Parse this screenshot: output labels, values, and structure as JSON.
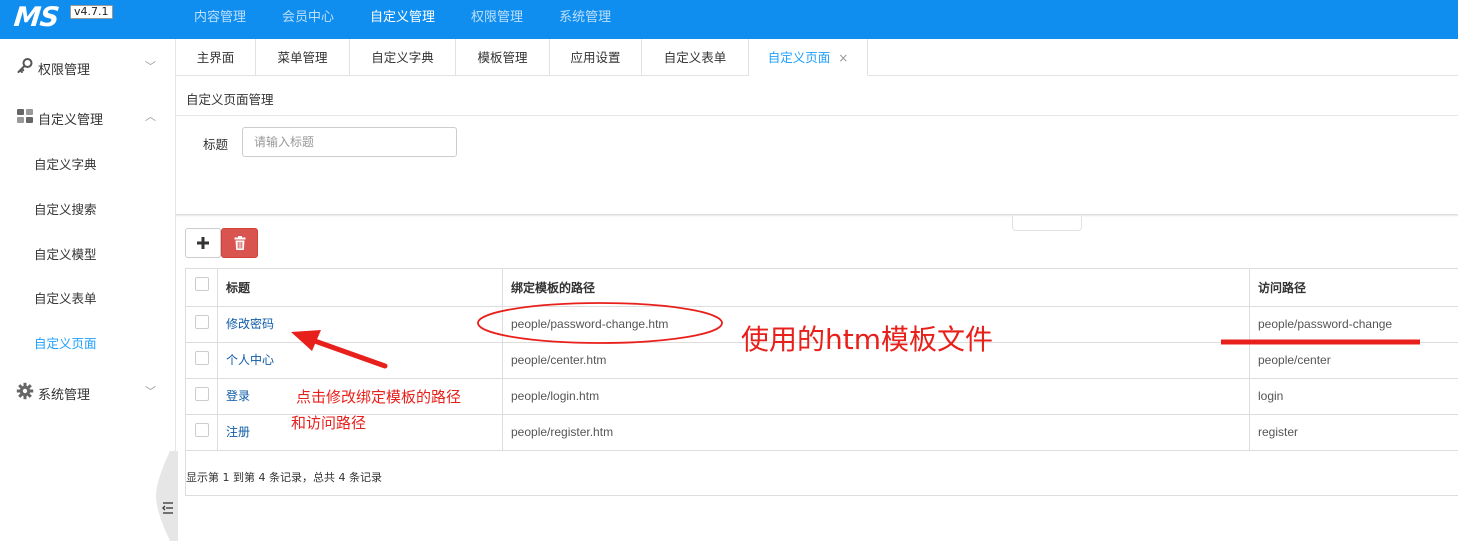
{
  "app": {
    "logo": "MS",
    "version": "v4.7.1"
  },
  "topnav": [
    "内容管理",
    "会员中心",
    "自定义管理",
    "权限管理",
    "系统管理"
  ],
  "sidebar": {
    "groups": [
      {
        "label": "权限管理",
        "icon": "key-icon"
      },
      {
        "label": "自定义管理",
        "icon": "grid-icon"
      },
      {
        "label": "系统管理",
        "icon": "gear-icon"
      }
    ],
    "items": [
      "自定义字典",
      "自定义搜索",
      "自定义模型",
      "自定义表单",
      "自定义页面"
    ]
  },
  "tabs": [
    "主界面",
    "菜单管理",
    "自定义字典",
    "模板管理",
    "应用设置",
    "自定义表单",
    "自定义页面"
  ],
  "tab_close": "×",
  "main": {
    "heading": "自定义页面管理",
    "search": {
      "label": "标题",
      "placeholder": "请输入标题",
      "value": ""
    }
  },
  "buttons": {
    "add": "+",
    "delete": "delete"
  },
  "table": {
    "headers": [
      "标题",
      "绑定模板的路径",
      "访问路径"
    ],
    "rows": [
      {
        "title": "修改密码",
        "template": "people/password-change.htm",
        "url": "people/password-change"
      },
      {
        "title": "个人中心",
        "template": "people/center.htm",
        "url": "people/center"
      },
      {
        "title": "登录",
        "template": "people/login.htm",
        "url": "login"
      },
      {
        "title": "注册",
        "template": "people/register.htm",
        "url": "register"
      }
    ],
    "pager_info": "显示第 1 到第 4 条记录，总共 4 条记录"
  },
  "annotations": {
    "big": "使用的htm模板文件",
    "small_line1": "点击修改绑定模板的路径",
    "small_line2": "和访问路径",
    "color": "#e8201b"
  },
  "colors": {
    "topbar": "#0f8ef0",
    "accent": "#1e9fff",
    "link": "#0e5ba8",
    "danger": "#d9534f"
  }
}
